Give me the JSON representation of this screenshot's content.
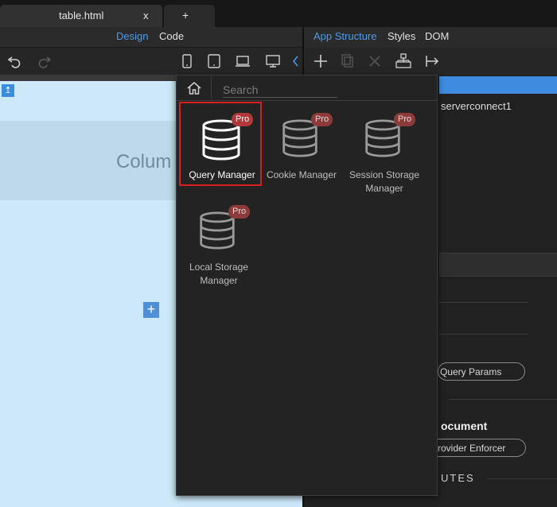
{
  "tabs": {
    "active_label": "table.html",
    "close_label": "x",
    "new_tab_label": "+"
  },
  "left_header": {
    "design_label": "Design",
    "code_label": "Code"
  },
  "canvas": {
    "column_text": "Colum"
  },
  "right_header": {
    "app_structure_label": "App Structure",
    "styles_label": "Styles",
    "dom_label": "DOM"
  },
  "right_panel": {
    "serverconnect_label": "serverconnect1",
    "query_params_label": "Query Params",
    "document_label": "ocument",
    "provider_label": "rovider Enforcer",
    "utes_label": "UTES"
  },
  "popup": {
    "search_placeholder": "Search",
    "items": [
      {
        "label": "Query Manager",
        "badge": "Pro",
        "selected": true
      },
      {
        "label": "Cookie Manager",
        "badge": "Pro"
      },
      {
        "label": "Session Storage Manager",
        "badge": "Pro"
      },
      {
        "label": "Local Storage Manager",
        "badge": "Pro"
      }
    ]
  },
  "colors": {
    "accent": "#4c9be8",
    "selection_outline": "#d81e1e",
    "pro_badge": "#8c3a3a",
    "canvas_bg": "#cde9f9"
  }
}
